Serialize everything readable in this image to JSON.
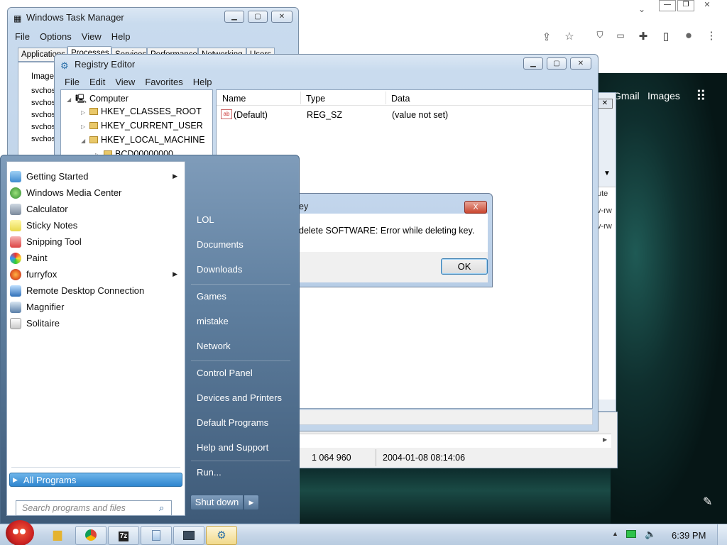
{
  "browser": {
    "links": [
      "Gmail",
      "Images"
    ],
    "snippets": [
      "ute",
      "v-rw",
      "v-rw"
    ]
  },
  "task_manager": {
    "title": "Windows Task Manager",
    "menu": [
      "File",
      "Options",
      "View",
      "Help"
    ],
    "tabs": [
      "Applications",
      "Processes",
      "Services",
      "Performance",
      "Networking",
      "Users"
    ],
    "column_header": "Image",
    "rows": [
      "svchost",
      "svchost",
      "svchost",
      "svchost",
      "svchost"
    ],
    "status": {
      "memory": "1 064 960",
      "date": "2004-01-08 08:14:06"
    }
  },
  "registry": {
    "title": "Registry Editor",
    "menu": [
      "File",
      "Edit",
      "View",
      "Favorites",
      "Help"
    ],
    "tree": {
      "root": "Computer",
      "keys": [
        "HKEY_CLASSES_ROOT",
        "HKEY_CURRENT_USER",
        "HKEY_LOCAL_MACHINE",
        "BCD00000000"
      ]
    },
    "columns": {
      "name": "Name",
      "type": "Type",
      "data": "Data"
    },
    "values": [
      {
        "name": "(Default)",
        "type": "REG_SZ",
        "data": "(value not set)"
      }
    ]
  },
  "dialog": {
    "title": "ey",
    "message": "delete SOFTWARE:  Error while deleting key.",
    "ok_label": "OK",
    "close_label": "X"
  },
  "start_menu": {
    "programs": [
      {
        "label": "Getting Started",
        "submenu": true
      },
      {
        "label": "Windows Media Center",
        "submenu": false
      },
      {
        "label": "Calculator",
        "submenu": false
      },
      {
        "label": "Sticky Notes",
        "submenu": false
      },
      {
        "label": "Snipping Tool",
        "submenu": false
      },
      {
        "label": "Paint",
        "submenu": false
      },
      {
        "label": "furryfox",
        "submenu": true
      },
      {
        "label": "Remote Desktop Connection",
        "submenu": false
      },
      {
        "label": "Magnifier",
        "submenu": false
      },
      {
        "label": "Solitaire",
        "submenu": false
      }
    ],
    "all_programs": "All Programs",
    "search_placeholder": "Search programs and files",
    "right_items": [
      "LOL",
      "Documents",
      "Downloads",
      "Games",
      "mistake",
      "Network",
      "Control Panel",
      "Devices and Printers",
      "Default Programs",
      "Help and Support",
      "Run..."
    ],
    "shutdown": "Shut down"
  },
  "taskbar": {
    "clock": "6:39 PM",
    "items": [
      "explorer",
      "chrome",
      "7-zip",
      "notepad",
      "task-manager",
      "registry-editor"
    ]
  },
  "colors": {
    "accent": "#2f86cf",
    "close": "#c9462f"
  }
}
